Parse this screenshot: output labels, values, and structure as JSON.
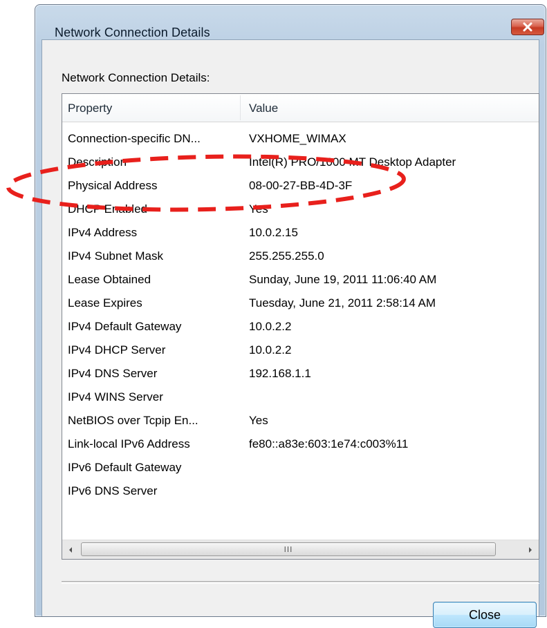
{
  "window": {
    "title": "Network Connection Details",
    "close_glyph": "close-icon"
  },
  "dialog": {
    "group_label": "Network Connection Details:",
    "columns": [
      "Property",
      "Value"
    ],
    "rows": [
      {
        "property": "Connection-specific DN...",
        "value": "VXHOME_WIMAX"
      },
      {
        "property": "Description",
        "value": "Intel(R) PRO/1000 MT Desktop Adapter"
      },
      {
        "property": "Physical Address",
        "value": "08-00-27-BB-4D-3F"
      },
      {
        "property": "DHCP Enabled",
        "value": "Yes"
      },
      {
        "property": "IPv4 Address",
        "value": "10.0.2.15"
      },
      {
        "property": "IPv4 Subnet Mask",
        "value": "255.255.255.0"
      },
      {
        "property": "Lease Obtained",
        "value": "Sunday, June 19, 2011 11:06:40 AM"
      },
      {
        "property": "Lease Expires",
        "value": "Tuesday, June 21, 2011 2:58:14 AM"
      },
      {
        "property": "IPv4 Default Gateway",
        "value": "10.0.2.2"
      },
      {
        "property": "IPv4 DHCP Server",
        "value": "10.0.2.2"
      },
      {
        "property": "IPv4 DNS Server",
        "value": "192.168.1.1"
      },
      {
        "property": "IPv4 WINS Server",
        "value": ""
      },
      {
        "property": "NetBIOS over Tcpip En...",
        "value": "Yes"
      },
      {
        "property": "Link-local IPv6 Address",
        "value": "fe80::a83e:603:1e74:c003%11"
      },
      {
        "property": "IPv6 Default Gateway",
        "value": ""
      },
      {
        "property": "IPv6 DNS Server",
        "value": ""
      }
    ],
    "scrollbar": {
      "grip": "III"
    },
    "close_button": "Close"
  },
  "colors": {
    "annotation": "#e8201c",
    "title_close_red": "#c63b24",
    "button_blue": "#3c7fb1"
  }
}
